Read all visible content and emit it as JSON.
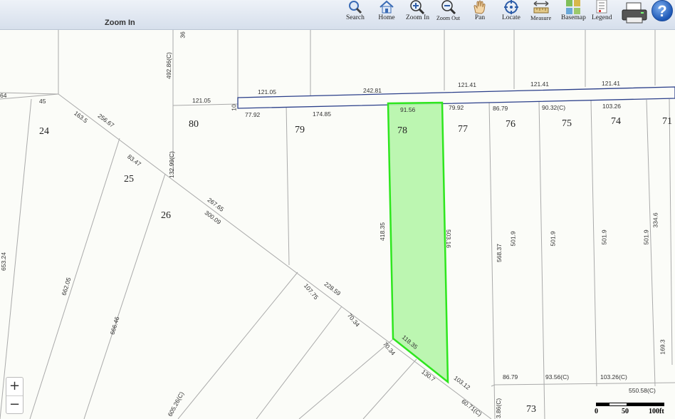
{
  "toolbar": {
    "title": "Zoom In",
    "tools": {
      "search": "Search",
      "home": "Home",
      "zoom_in": "Zoom In",
      "zoom_out": "Zoom Out",
      "pan": "Pan",
      "locate": "Locate",
      "measure": "Measure",
      "basemap": "Basemap",
      "legend": "Legend"
    },
    "help": "?"
  },
  "map": {
    "lots": {
      "l24": "24",
      "l25": "25",
      "l26": "26",
      "l80": "80",
      "l79": "79",
      "l78": "78",
      "l77": "77",
      "l76": "76",
      "l75": "75",
      "l74": "74",
      "l71": "71",
      "l73": "73"
    },
    "dims": {
      "d64": "64",
      "d45": "45",
      "d163_5": "163.5",
      "d256_67": "256.67",
      "d492": "492.86(C)",
      "d36": "36",
      "d121_05a": "121.05",
      "d121_05b": "121.05",
      "d242_81": "242.81",
      "d121_41a": "121.41",
      "d121_41b": "121.41",
      "d121_41c": "121.41",
      "d10": "10",
      "d77_92": "77.92",
      "d174_85": "174.85",
      "d91_56": "91.56",
      "d79_92": "79.92",
      "d86_79a": "86.79",
      "d90_32": "90.32(C)",
      "d103_26a": "103.26",
      "d83_47": "83.47",
      "d132": "132.99(C)",
      "d267_65": "267.65",
      "d300_09": "300.09",
      "d653": "653.24",
      "d662": "662.05",
      "d666": "666.46",
      "d418": "418.35",
      "d503": "503.16",
      "d568": "568.37",
      "d501_9a": "501.9",
      "d501_9b": "501.9",
      "d501_9c": "501.9",
      "d501_9d": "501.9",
      "d334": "334.6",
      "d228": "228.59",
      "d107": "107.75",
      "d70_34a": "70.34",
      "d70_34b": "70.34",
      "d118": "118.35",
      "d130": "130.7",
      "d103_12": "103.12",
      "d86_79b": "86.79",
      "d93_56": "93.56(C)",
      "d103_26b": "103.26(C)",
      "d169": "169.3",
      "d550": "550.58(C)",
      "d605": "605.26(C)",
      "d60_71": "60.71(C)",
      "d3_86": "3.86(C)"
    },
    "zoom_in": "+",
    "zoom_out": "−",
    "scale": {
      "s0": "0",
      "s50": "50",
      "s100": "100ft"
    },
    "colors": {
      "selected_fill": "#b5f5a8",
      "selected_stroke": "#2ee61e",
      "road": "#2b3f8a"
    }
  }
}
